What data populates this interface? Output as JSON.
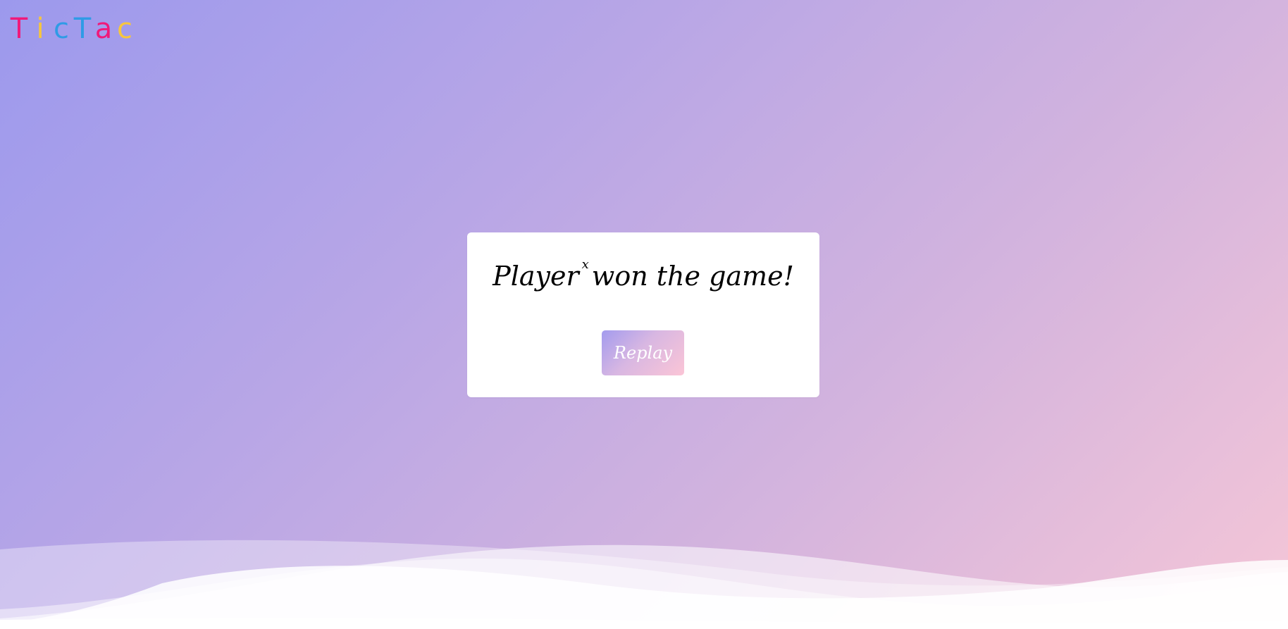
{
  "logo": {
    "letters": [
      {
        "char": "T",
        "color": "#f0197a"
      },
      {
        "char": "i",
        "color": "#f7c63d"
      },
      {
        "char": "c",
        "color": "#2f9be6"
      },
      {
        "char": "T",
        "color": "#2f9be6"
      },
      {
        "char": "a",
        "color": "#f0197a"
      },
      {
        "char": "c",
        "color": "#f7c63d"
      }
    ]
  },
  "modal": {
    "message_prefix": "Player",
    "winner_mark": "x",
    "message_suffix": "won the game!",
    "replay_label": "Replay"
  },
  "colors": {
    "background_start": "#9c99ed",
    "background_end": "#f5c6d7",
    "modal_bg": "#ffffff"
  }
}
